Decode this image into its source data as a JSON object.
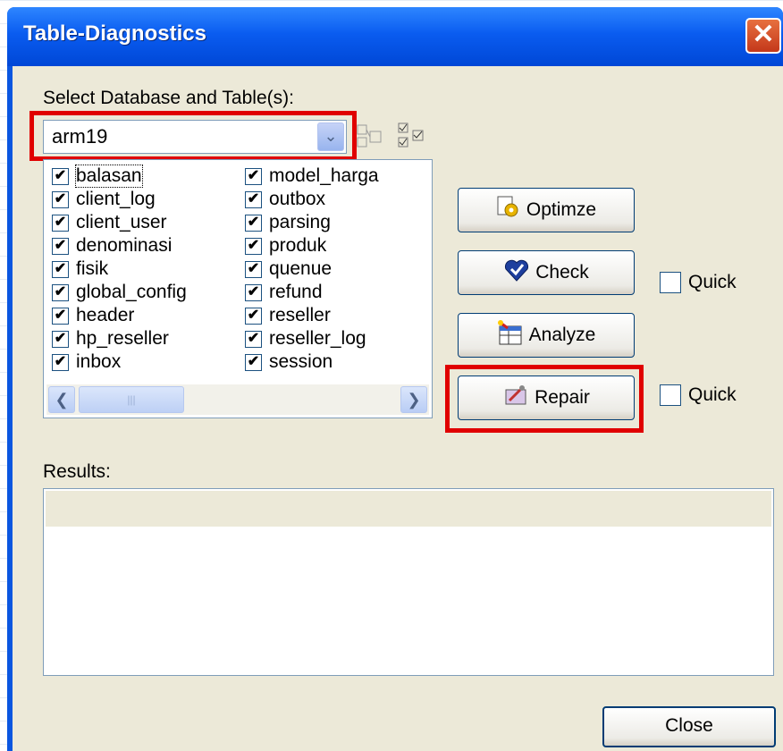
{
  "window": {
    "title": "Table-Diagnostics",
    "close_glyph": "✕"
  },
  "select_label": "Select Database and Table(s):",
  "database": {
    "value": "arm19",
    "dropdown_glyph": "⌄"
  },
  "toolbar_icons": [
    "deselect-all-icon",
    "select-all-icon"
  ],
  "tables": {
    "col1": [
      "balasan",
      "client_log",
      "client_user",
      "denominasi",
      "fisik",
      "global_config",
      "header",
      "hp_reseller",
      "inbox"
    ],
    "col2": [
      "model_harga",
      "outbox",
      "parsing",
      "produk",
      "quenue",
      "refund",
      "reseller",
      "reseller_log",
      "session"
    ],
    "check_glyph": "✔"
  },
  "scroll": {
    "left": "❮",
    "right": "❯",
    "grip": "|||"
  },
  "buttons": {
    "optimize": "Optimze",
    "check": "Check",
    "analyze": "Analyze",
    "repair": "Repair"
  },
  "icons": {
    "optimize": "optimize-gears-icon",
    "check": "check-heart-icon",
    "analyze": "analyze-table-icon",
    "repair": "repair-tools-icon"
  },
  "quick_label": "Quick",
  "results_label": "Results:",
  "close_label": "Close",
  "colors": {
    "titlebar": "#0a5cf0",
    "highlight": "#e00000",
    "face": "#ece9d8"
  }
}
